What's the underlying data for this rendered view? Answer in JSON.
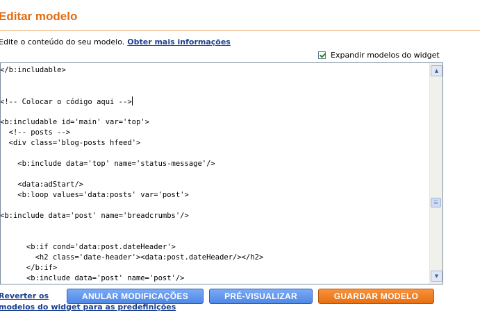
{
  "header": {
    "title": "Editar modelo"
  },
  "intro": {
    "text": "Edite o conteúdo do seu modelo.",
    "link": "Obter mais informações"
  },
  "expand_widgets": {
    "label": "Expandir modelos do widget",
    "checked": true
  },
  "editor": {
    "lines": [
      "</b:includable>",
      "",
      "",
      "<!-- Colocar o código aqui -->",
      "",
      "<b:includable id='main' var='top'>",
      "  <!-- posts -->",
      "  <div class='blog-posts hfeed'>",
      "",
      "    <b:include data='top' name='status-message'/>",
      "",
      "    <data:adStart/>",
      "    <b:loop values='data:posts' var='post'>",
      "",
      "<b:include data='post' name='breadcrumbs'/>",
      "",
      "",
      "      <b:if cond='data:post.dateHeader'>",
      "        <h2 class='date-header'><data:post.dateHeader/></h2>",
      "      </b:if>",
      "      <b:include data='post' name='post'/>"
    ]
  },
  "footer": {
    "revert_line1": "Reverter os",
    "revert_line2": "modelos do widget para as predefinições",
    "cancel_label": "ANULAR MODIFICAÇÕES",
    "preview_label": "PRÉ-VISUALIZAR",
    "save_label": "GUARDAR MODELO"
  },
  "colors": {
    "title": "#e36b10",
    "link": "#1b3f8f",
    "button_blue": "#5b92ea",
    "button_orange": "#ee7a1c"
  },
  "icons": {
    "scroll_up": "▲",
    "scroll_down": "▼"
  }
}
